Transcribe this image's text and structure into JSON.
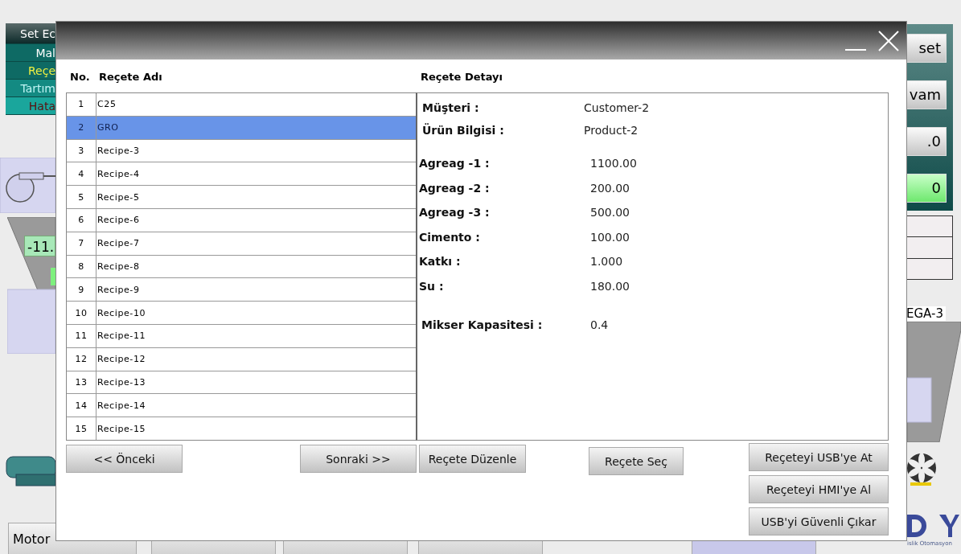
{
  "background": {
    "side_menu": [
      {
        "label": "Set Ec",
        "kind": "header",
        "color": "#ffffff"
      },
      {
        "label": "Mal",
        "kind": "item",
        "color": "#ffffff"
      },
      {
        "label": "Reçe",
        "kind": "item",
        "color": "#f0f040"
      },
      {
        "label": "Tartım",
        "kind": "item",
        "color": "#bff4f4"
      },
      {
        "label": "Hata",
        "kind": "item",
        "color": "#5a1010"
      }
    ],
    "right_buttons": [
      {
        "label": "set",
        "kind": "button"
      },
      {
        "label": "vam",
        "kind": "button"
      },
      {
        "label": ".0",
        "kind": "button"
      },
      {
        "label": "0",
        "kind": "status"
      }
    ],
    "scale_reading": "-11.",
    "bin_label": "EGA-3",
    "bottom_tabs": [
      {
        "label": "Motor",
        "selected": false
      },
      {
        "selected": false
      },
      {
        "selected": false
      },
      {
        "selected": false
      },
      {
        "selected": true
      }
    ],
    "logo_caption": "islik Otomasyon"
  },
  "dialog": {
    "column_no": "No.",
    "column_name": "Reçete Adı",
    "detail_title": "Reçete Detayı",
    "recipes": [
      {
        "no": "1",
        "name": "C25",
        "selected": false
      },
      {
        "no": "2",
        "name": "GRO",
        "selected": true
      },
      {
        "no": "3",
        "name": "Recipe-3",
        "selected": false
      },
      {
        "no": "4",
        "name": "Recipe-4",
        "selected": false
      },
      {
        "no": "5",
        "name": "Recipe-5",
        "selected": false
      },
      {
        "no": "6",
        "name": "Recipe-6",
        "selected": false
      },
      {
        "no": "7",
        "name": "Recipe-7",
        "selected": false
      },
      {
        "no": "8",
        "name": "Recipe-8",
        "selected": false
      },
      {
        "no": "9",
        "name": "Recipe-9",
        "selected": false
      },
      {
        "no": "10",
        "name": "Recipe-10",
        "selected": false
      },
      {
        "no": "11",
        "name": "Recipe-11",
        "selected": false
      },
      {
        "no": "12",
        "name": "Recipe-12",
        "selected": false
      },
      {
        "no": "13",
        "name": "Recipe-13",
        "selected": false
      },
      {
        "no": "14",
        "name": "Recipe-14",
        "selected": false
      },
      {
        "no": "15",
        "name": "Recipe-15",
        "selected": false
      }
    ],
    "details": [
      {
        "label": "Müşteri :",
        "value": "Customer-2",
        "kind": "info"
      },
      {
        "label": "Ürün Bilgisi :",
        "value": "Product-2",
        "kind": "info"
      },
      {
        "label": "Agreag -1 :",
        "value": "1100.00",
        "kind": "amount"
      },
      {
        "label": "Agreag -2 :",
        "value": "200.00",
        "kind": "amount"
      },
      {
        "label": "Agreag -3 :",
        "value": "500.00",
        "kind": "amount"
      },
      {
        "label": "Cimento :",
        "value": "100.00",
        "kind": "amount"
      },
      {
        "label": "Katkı :",
        "value": "1.000",
        "kind": "amount"
      },
      {
        "label": "Su :",
        "value": "180.00",
        "kind": "amount"
      },
      {
        "label": "Mikser Kapasitesi :",
        "value": "0.4",
        "kind": "capacity"
      }
    ],
    "previous_button": "<< Önceki",
    "next_button": "Sonraki >>",
    "edit_button": "Reçete Düzenle",
    "select_button": "Reçete Seç",
    "usb_buttons": [
      "Reçeteyi USB'ye At",
      "Reçeteyi HMI'ye Al",
      "USB'yi Güvenli Çıkar"
    ]
  }
}
